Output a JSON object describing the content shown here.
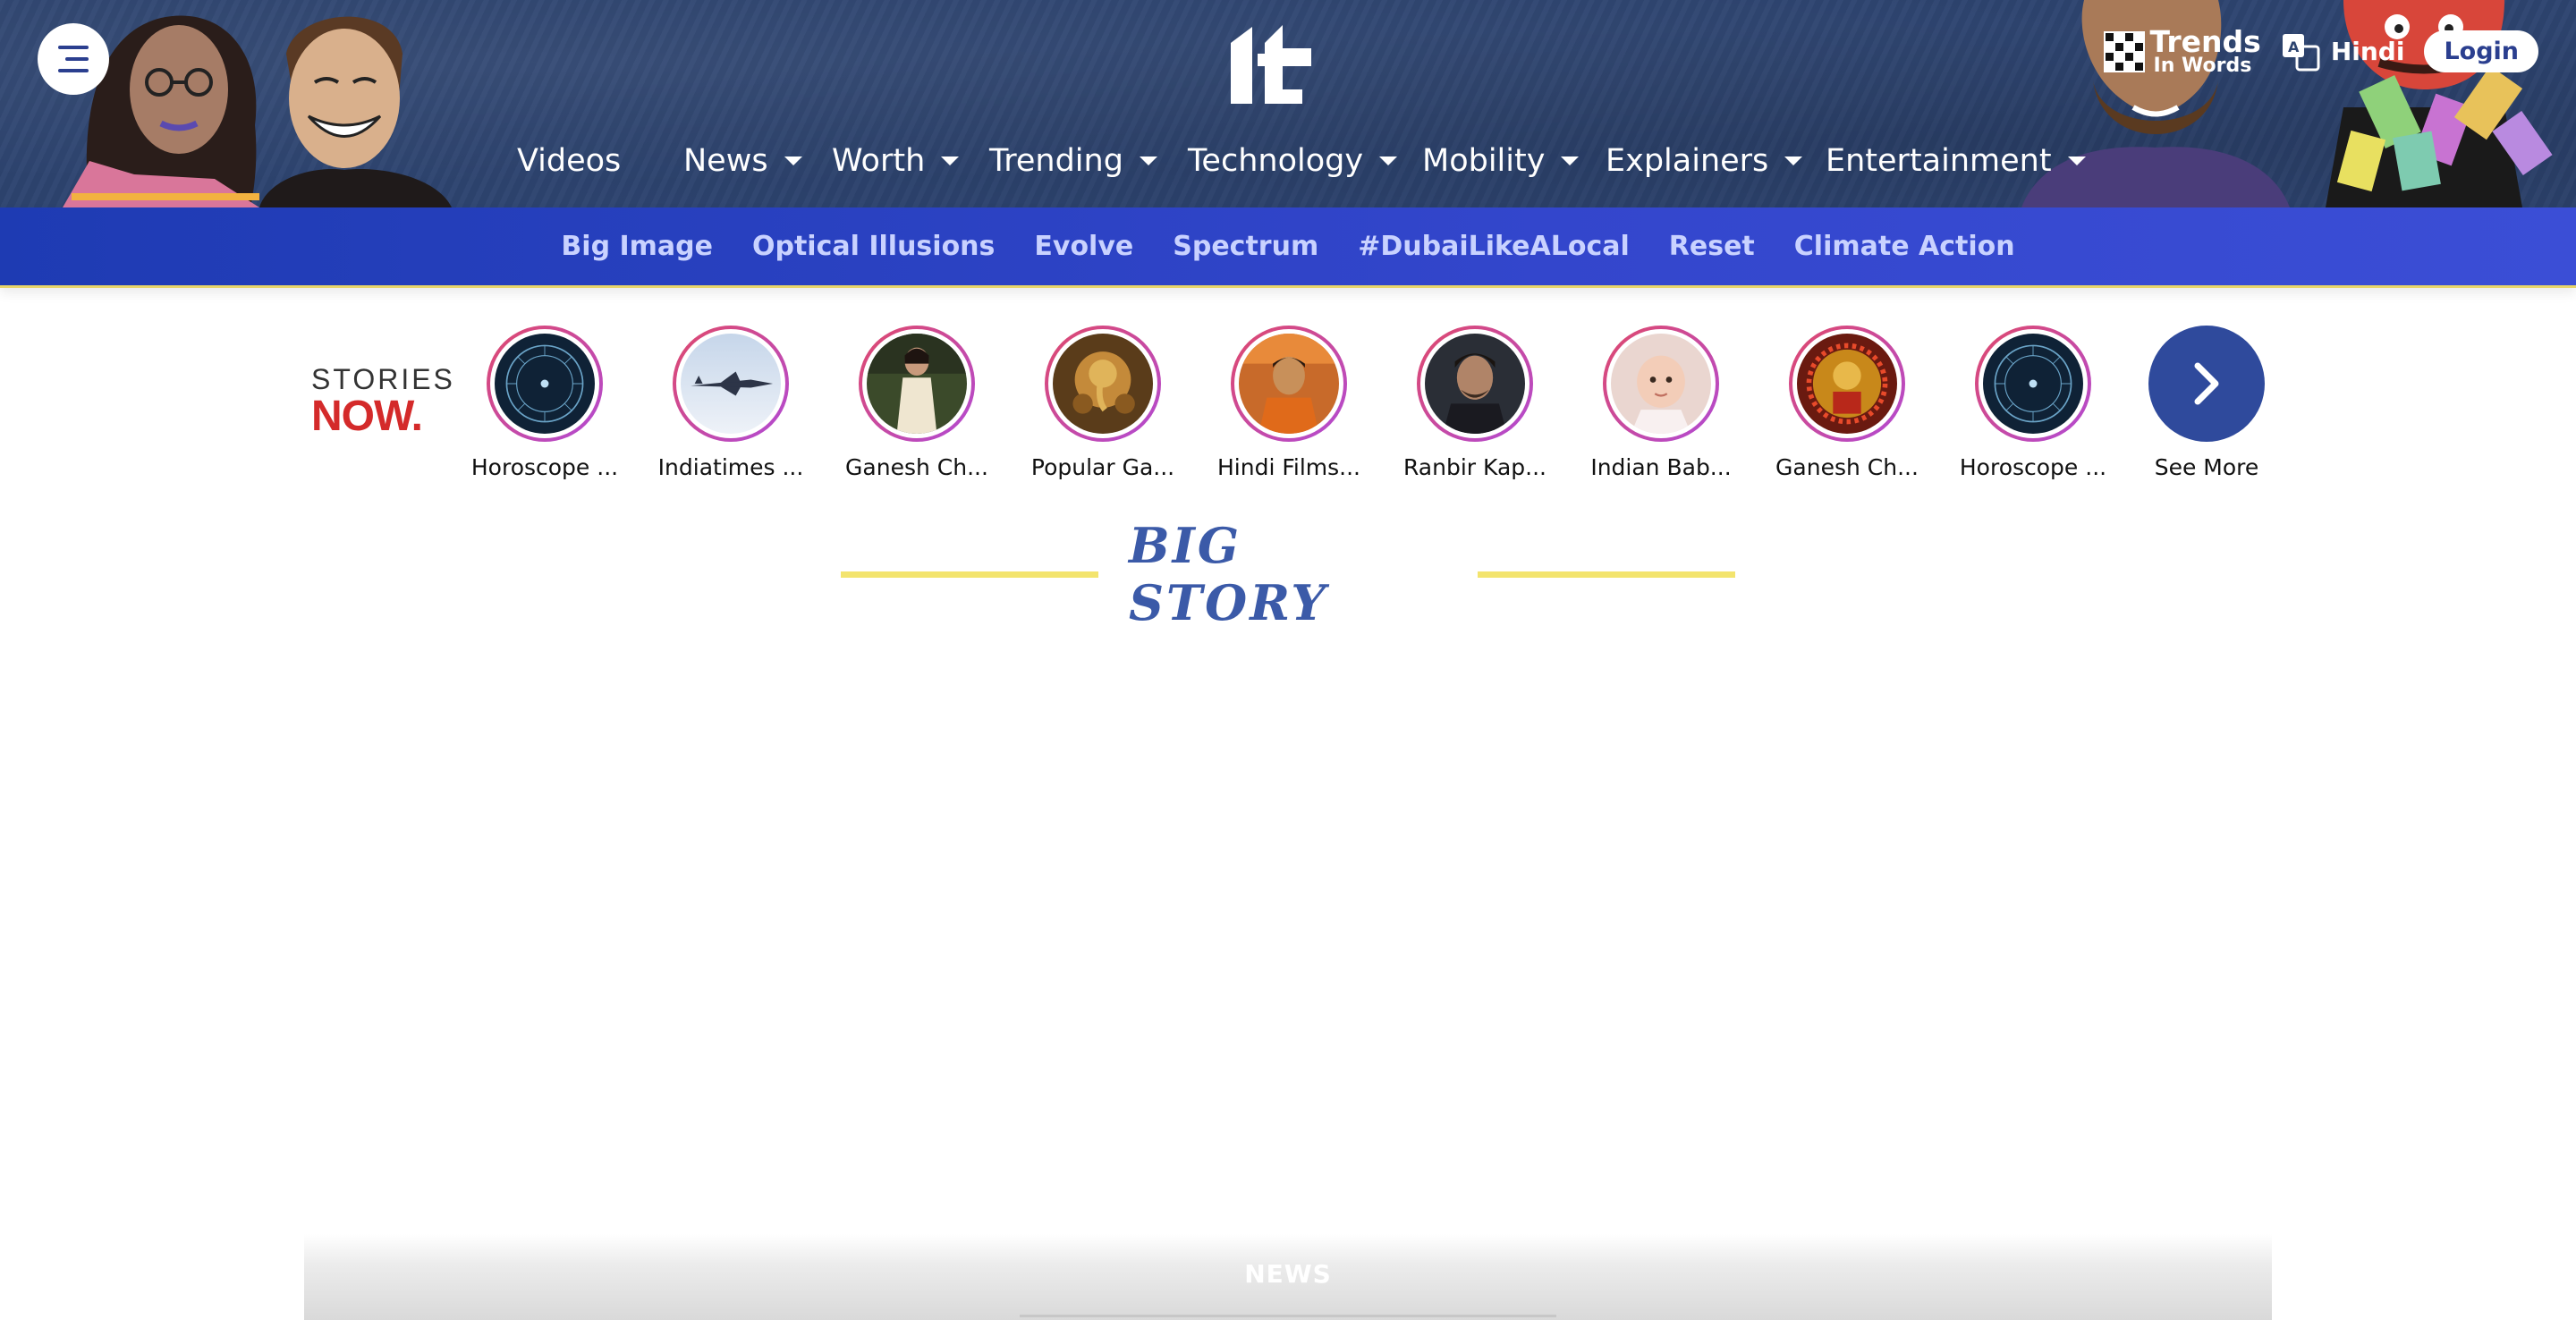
{
  "header": {
    "logo_alt": "indiatimes",
    "nav": [
      {
        "label": "Videos",
        "has_dropdown": false
      },
      {
        "label": "News",
        "has_dropdown": true
      },
      {
        "label": "Worth",
        "has_dropdown": true
      },
      {
        "label": "Trending",
        "has_dropdown": true
      },
      {
        "label": "Technology",
        "has_dropdown": true
      },
      {
        "label": "Mobility",
        "has_dropdown": true
      },
      {
        "label": "Explainers",
        "has_dropdown": true
      },
      {
        "label": "Entertainment",
        "has_dropdown": true
      }
    ],
    "trends": {
      "line1": "Trends",
      "line2": "In Words"
    },
    "language_label": "Hindi",
    "login_label": "Login"
  },
  "subnav": {
    "items": [
      "Big Image",
      "Optical Illusions",
      "Evolve",
      "Spectrum",
      "#DubaiLikeALocal",
      "Reset",
      "Climate Action"
    ]
  },
  "stories": {
    "label_line1": "STORIES",
    "label_line2": "NOW.",
    "items": [
      {
        "label": "Horoscope ...",
        "thumb": "zodiac-wheel"
      },
      {
        "label": "Indiatimes ...",
        "thumb": "fighter-jet"
      },
      {
        "label": "Ganesh Ch...",
        "thumb": "woman-in-saree"
      },
      {
        "label": "Popular Ga...",
        "thumb": "ganesha-idol"
      },
      {
        "label": "Hindi Films...",
        "thumb": "actor-orange"
      },
      {
        "label": "Ranbir Kap...",
        "thumb": "actor-portrait"
      },
      {
        "label": "Indian Bab...",
        "thumb": "baby"
      },
      {
        "label": "Ganesh Ch...",
        "thumb": "decorated-idol"
      },
      {
        "label": "Horoscope ...",
        "thumb": "zodiac-wheel"
      }
    ],
    "see_more_label": "See More"
  },
  "big_story": {
    "title": "BIG STORY"
  },
  "news_section": {
    "label": "NEWS"
  },
  "colors": {
    "header_bg": "#2d4470",
    "subnav_bg": "#2c40c4",
    "subnav_text": "#c9d2ff",
    "brand_blue": "#2f4a9c",
    "stories_red": "#d42a2a",
    "big_story_text": "#3b5aa8",
    "accent_yellow": "#f3e46e"
  }
}
